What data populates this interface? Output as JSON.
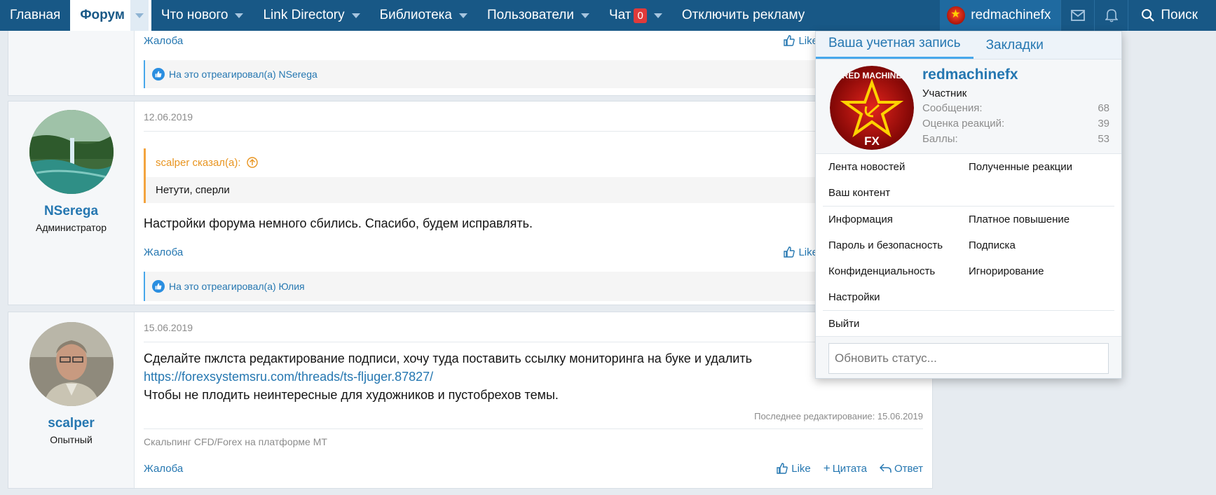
{
  "navbar": {
    "items": [
      {
        "label": "Главная"
      },
      {
        "label": "Форум"
      },
      {
        "label": "Что нового"
      },
      {
        "label": "Link Directory"
      },
      {
        "label": "Библиотека"
      },
      {
        "label": "Пользователи"
      },
      {
        "label": "Чат"
      },
      {
        "label": "Отключить рекламу"
      }
    ],
    "chat_badge": "0",
    "user": "redmachinefx",
    "search": "Поиск"
  },
  "post_prev": {
    "report": "Жалоба",
    "like": "Like",
    "reacted_by": "На это отреагировал(а) NSerega"
  },
  "post_nserega": {
    "username": "NSerega",
    "usertitle": "Администратор",
    "date": "12.06.2019",
    "quote_author": "scalper сказал(а):",
    "quote_text": "Нетути, сперли",
    "message": "Настройки форума немного сбились. Спасибо, будем исправлять.",
    "report": "Жалоба",
    "like": "Like",
    "reacted_by": "На это отреагировал(а) Юлия"
  },
  "post_scalper": {
    "username": "scalper",
    "usertitle": "Опытный",
    "date": "15.06.2019",
    "line1": "Сделайте пжлста редактирование подписи, хочу туда поставить ссылку мониторинга на буке и удалить",
    "link": "https://forexsystemsru.com/threads/ts-fljuger.87827/",
    "line3": "Чтобы не плодить неинтересные для художников и пустобрехов темы.",
    "last_edit": "Последнее редактирование: 15.06.2019",
    "signature": "Скальпинг CFD/Forex на платформе МТ",
    "report": "Жалоба",
    "like": "Like",
    "quote": "Цитата",
    "reply": "Ответ"
  },
  "account_menu": {
    "tabs": [
      "Ваша учетная запись",
      "Закладки"
    ],
    "username": "redmachinefx",
    "role": "Участник",
    "stats": [
      {
        "label": "Сообщения:",
        "value": "68"
      },
      {
        "label": "Оценка реакций:",
        "value": "39"
      },
      {
        "label": "Баллы:",
        "value": "53"
      }
    ],
    "links_1": [
      "Лента новостей",
      "Полученные реакции",
      "Ваш контент"
    ],
    "links_2": [
      "Информация",
      "Платное повышение",
      "Пароль и безопасность",
      "Подписка",
      "Конфиденциальность",
      "Игнорирование",
      "Настройки"
    ],
    "logout": "Выйти",
    "status_placeholder": "Обновить статус..."
  },
  "avatar_logo_text": "RED MACHINE FX"
}
